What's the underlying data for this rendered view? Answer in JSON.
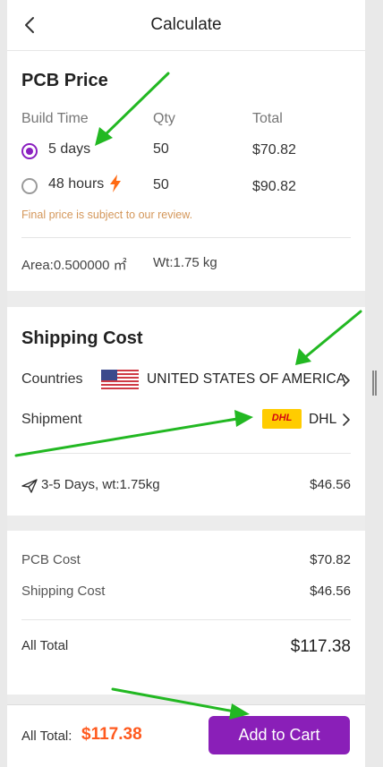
{
  "header": {
    "title": "Calculate"
  },
  "pcb_price": {
    "title": "PCB Price",
    "columns": {
      "build_time": "Build Time",
      "qty": "Qty",
      "total": "Total"
    },
    "options": [
      {
        "build_time": "5 days",
        "qty": "50",
        "total": "$70.82",
        "selected": true
      },
      {
        "build_time": "48 hours",
        "qty": "50",
        "total": "$90.82",
        "selected": false
      }
    ],
    "note": "Final price is subject to our review.",
    "area": "Area:0.500000 ㎡",
    "weight": "Wt:1.75 kg"
  },
  "shipping": {
    "title": "Shipping Cost",
    "countries_label": "Countries",
    "country": "UNITED STATES OF AMERICA",
    "shipment_label": "Shipment",
    "carrier": "DHL",
    "carrier_logo_text": "DHL",
    "delivery": "3-5 Days, wt:1.75kg",
    "cost": "$46.56"
  },
  "summary": {
    "pcb_cost_label": "PCB Cost",
    "pcb_cost": "$70.82",
    "shipping_cost_label": "Shipping Cost",
    "shipping_cost": "$46.56",
    "all_total_label": "All Total",
    "all_total": "$117.38"
  },
  "bottom_bar": {
    "all_total_label": "All Total:",
    "all_total": "$117.38",
    "add_to_cart_label": "Add to Cart"
  },
  "colors": {
    "accent": "#8a1fb8",
    "price": "#ff5a1f",
    "note": "#d4975a",
    "annotation_arrow": "#22b822"
  }
}
